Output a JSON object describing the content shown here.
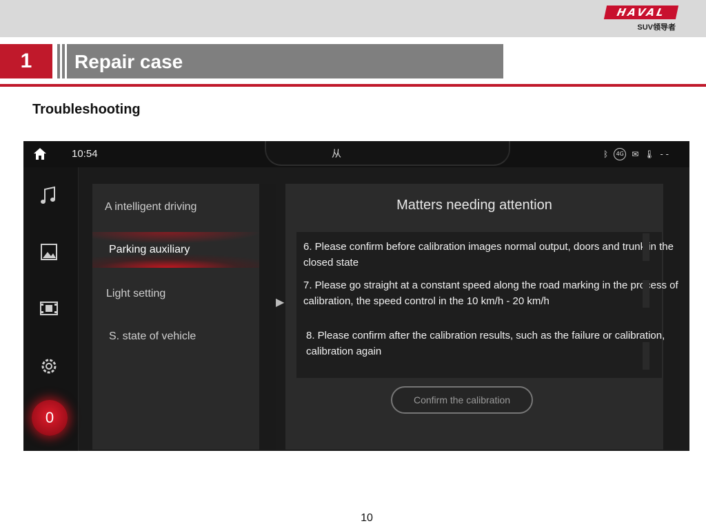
{
  "slide": {
    "logo_brand": "HAVAL",
    "logo_sub": "SUV领导者",
    "section_number": "1",
    "section_title": "Repair case",
    "subheading": "Troubleshooting",
    "page_number": "10"
  },
  "screen": {
    "status_bar": {
      "time": "10:54",
      "center_text": "从",
      "icons": [
        "bluetooth-icon",
        "4g-icon",
        "message-icon",
        "thermometer-icon"
      ]
    },
    "rail_icons": [
      "music-icon",
      "image-icon",
      "video-icon",
      "settings-icon"
    ],
    "rail_home_badge": "0",
    "menu_items": [
      {
        "label": "A intelligent driving"
      },
      {
        "label": "Parking auxiliary",
        "selected": true
      },
      {
        "label": "Light setting"
      },
      {
        "label": "S. state of vehicle"
      }
    ],
    "panel": {
      "title": "Matters needing attention",
      "notes": [
        "6. Please confirm before calibration images normal output, doors and trunk in the closed state",
        "7. Please go straight at a constant speed along the road marking in the process of calibration, the speed control in the 10 km/h - 20 km/h",
        "8. Please confirm after the calibration results, such as the failure or calibration, calibration again"
      ],
      "confirm_label": "Confirm the calibration"
    },
    "colors": {
      "accent_red": "#c0192b",
      "screen_bg": "#1b1b1b"
    }
  }
}
